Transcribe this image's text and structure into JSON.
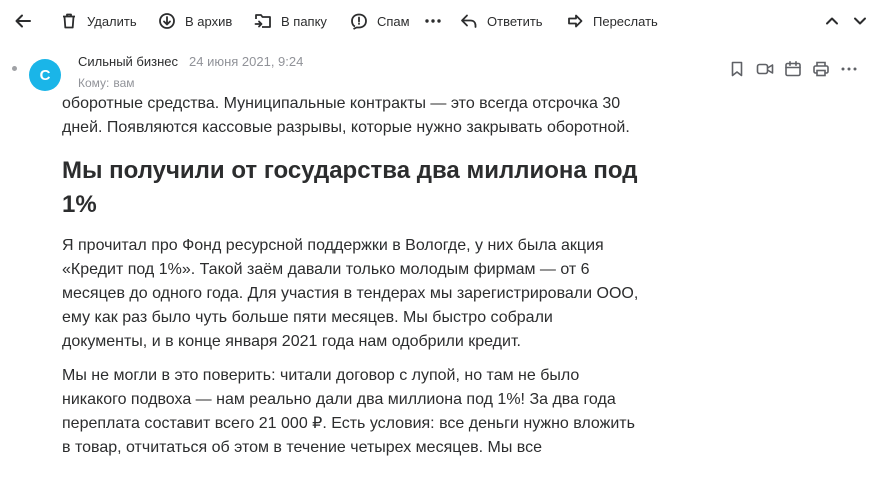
{
  "toolbar": {
    "delete_label": "Удалить",
    "archive_label": "В архив",
    "folder_label": "В папку",
    "spam_label": "Спам",
    "reply_label": "Ответить",
    "forward_label": "Переслать"
  },
  "message": {
    "avatar_letter": "С",
    "sender": "Сильный бизнес",
    "date": "24 июня 2021, 9:24",
    "to_label": "Кому:",
    "to_value": "вам"
  },
  "body": {
    "p0": "оборотные средства. Муниципальные контракты — это всегда отсрочка 30 дней. Появляются кассовые разрывы, которые нужно закрывать оборотной.",
    "heading": "Мы получили от государства два миллиона под 1%",
    "p1": "Я прочитал про Фонд ресурсной поддержки в Вологде, у них была акция «Кредит под 1%». Такой заём давали только молодым фирмам — от 6 месяцев до одного года. Для участия в тендерах мы зарегистрировали ООО, ему как раз было чуть больше пяти месяцев. Мы быстро собрали документы, и в конце января 2021 года нам одобрили кредит.",
    "p2": "Мы не могли в это поверить: читали договор с лупой, но там не было никакого подвоха — нам реально дали два миллиона под 1%! За два года переплата составит всего 21 000 ₽. Есть условия: все деньги нужно вложить в товар, отчитаться об этом в течение четырех месяцев. Мы все"
  },
  "colors": {
    "avatar": "#1ab5e8",
    "text": "#2c2d2e",
    "muted": "#919399"
  }
}
